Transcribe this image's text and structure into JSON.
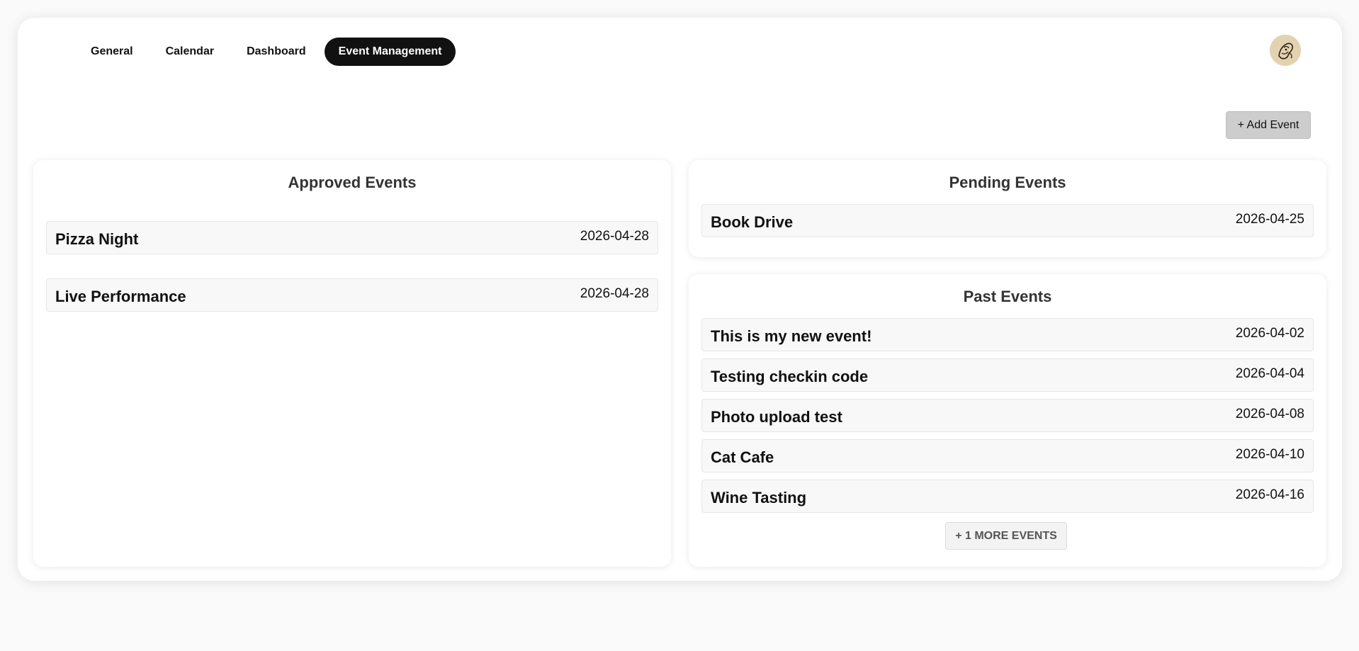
{
  "nav": {
    "tabs": [
      {
        "label": "General",
        "active": false
      },
      {
        "label": "Calendar",
        "active": false
      },
      {
        "label": "Dashboard",
        "active": false
      },
      {
        "label": "Event Management",
        "active": true
      }
    ]
  },
  "toolbar": {
    "add_event_label": "+ Add Event"
  },
  "approved": {
    "title": "Approved Events",
    "events": [
      {
        "name": "Pizza Night",
        "date": "2026-04-28"
      },
      {
        "name": "Live Performance",
        "date": "2026-04-28"
      }
    ]
  },
  "pending": {
    "title": "Pending Events",
    "events": [
      {
        "name": "Book Drive",
        "date": "2026-04-25"
      }
    ]
  },
  "past": {
    "title": "Past Events",
    "events": [
      {
        "name": "This is my new event!",
        "date": "2026-04-02"
      },
      {
        "name": "Testing checkin code",
        "date": "2026-04-04"
      },
      {
        "name": "Photo upload test",
        "date": "2026-04-08"
      },
      {
        "name": "Cat Cafe",
        "date": "2026-04-10"
      },
      {
        "name": "Wine Tasting",
        "date": "2026-04-16"
      }
    ],
    "more_label": "+ 1 MORE EVENTS"
  },
  "colors": {
    "active_tab_bg": "#111111",
    "page_bg": "#fafafa",
    "row_bg": "#f8f8f8"
  }
}
